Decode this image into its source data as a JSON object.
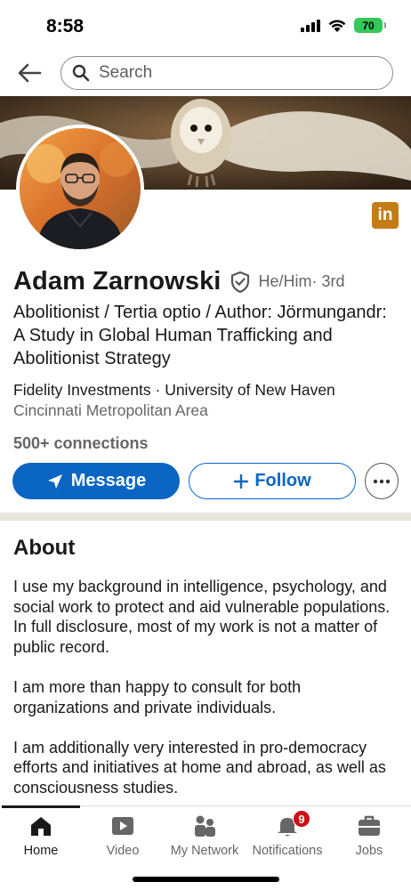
{
  "status_bar": {
    "time": "8:58",
    "battery": "70"
  },
  "search": {
    "placeholder": "Search"
  },
  "profile": {
    "name": "Adam Zarnowski",
    "pronouns": "He/Him",
    "degree": " · 3rd",
    "headline": "Abolitionist / Tertia optio / Author: Jörmungandr: A Study in Global Human Trafficking and Abolitionist Strategy",
    "affiliations": "Fidelity Investments · University of New Haven",
    "location": "Cincinnati Metropolitan Area",
    "connections": "500+ connections",
    "li_badge": "in"
  },
  "actions": {
    "message_label": "Message",
    "follow_label": "Follow"
  },
  "about": {
    "title": "About",
    "paragraphs": [
      "I use my background in intelligence, psychology, and social work to protect and aid vulnerable populations. In full disclosure, most of my work is not a matter of public record.",
      "I am more than happy to consult for both organizations and private individuals.",
      "I am additionally very interested in pro-democracy efforts and initiatives at home and abroad, as well as consciousness studies."
    ]
  },
  "nav": {
    "items": [
      {
        "label": "Home",
        "icon": "home-icon",
        "active": true
      },
      {
        "label": "Video",
        "icon": "video-icon"
      },
      {
        "label": "My Network",
        "icon": "my-network-icon"
      },
      {
        "label": "Notifications",
        "icon": "bell-icon",
        "badge": "9"
      },
      {
        "label": "Jobs",
        "icon": "briefcase-icon"
      }
    ]
  },
  "colors": {
    "brand_blue": "#0a66c2",
    "badge_red": "#cc1016",
    "linkedin_badge": "#c37d16"
  }
}
